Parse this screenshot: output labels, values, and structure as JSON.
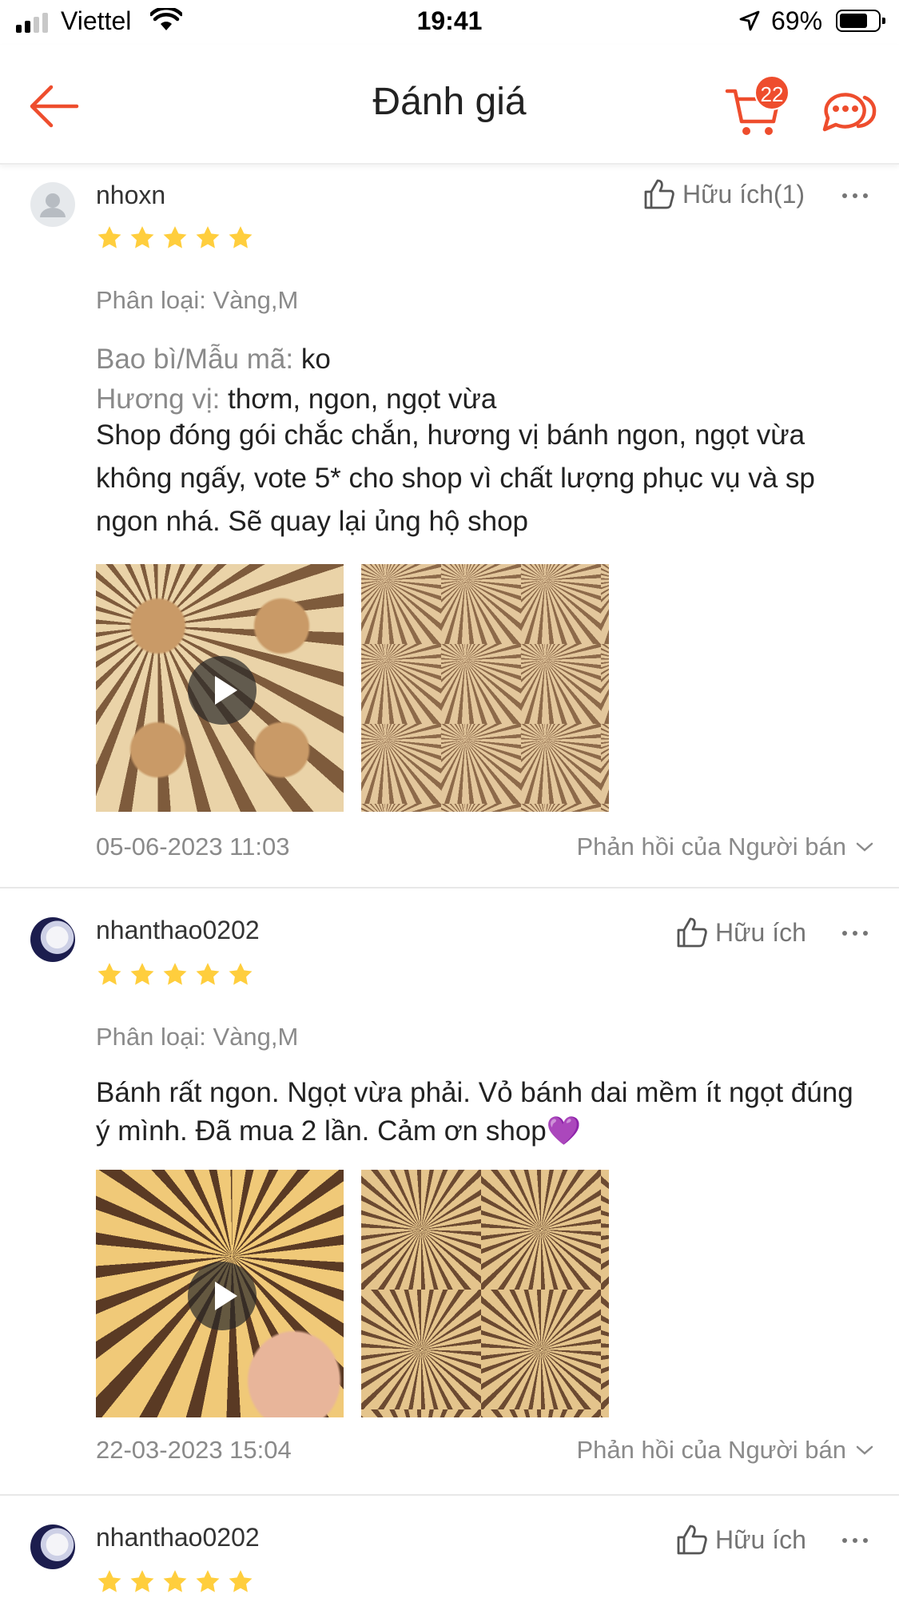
{
  "status_bar": {
    "carrier": "Viettel",
    "time": "19:41",
    "battery": "69%"
  },
  "header": {
    "title": "Đánh giá",
    "cart_count": "22",
    "accent_color": "#ee4d2d"
  },
  "reviews": [
    {
      "username": "nhoxn",
      "rating": 5,
      "helpful_label": "Hữu ích(1)",
      "variation": "Phân loại: Vàng,M",
      "attributes": [
        {
          "key": "Bao bì/Mẫu mã:",
          "value": "ko"
        },
        {
          "key": "Hương vị:",
          "value": "thơm, ngon, ngọt vừa"
        }
      ],
      "text": "Shop đóng gói chắc chắn, hương vị bánh ngon, ngọt vừa không ngấy, vote 5* cho shop vì chất lượng phục vụ và sp ngon nhá. Sẽ quay lại ủng hộ shop",
      "date": "05-06-2023 11:03",
      "seller_reply_label": "Phản hồi của Người bán"
    },
    {
      "username": "nhanthao0202",
      "rating": 5,
      "helpful_label": "Hữu ích",
      "variation": "Phân loại: Vàng,M",
      "text": "Bánh rất ngon. Ngọt vừa phải. Vỏ bánh dai mềm ít ngọt đúng ý mình. Đã mua 2 lần. Cảm ơn shop💜",
      "date": "22-03-2023 15:04",
      "seller_reply_label": "Phản hồi của Người bán"
    },
    {
      "username": "nhanthao0202",
      "rating": 5,
      "helpful_label": "Hữu ích"
    }
  ]
}
